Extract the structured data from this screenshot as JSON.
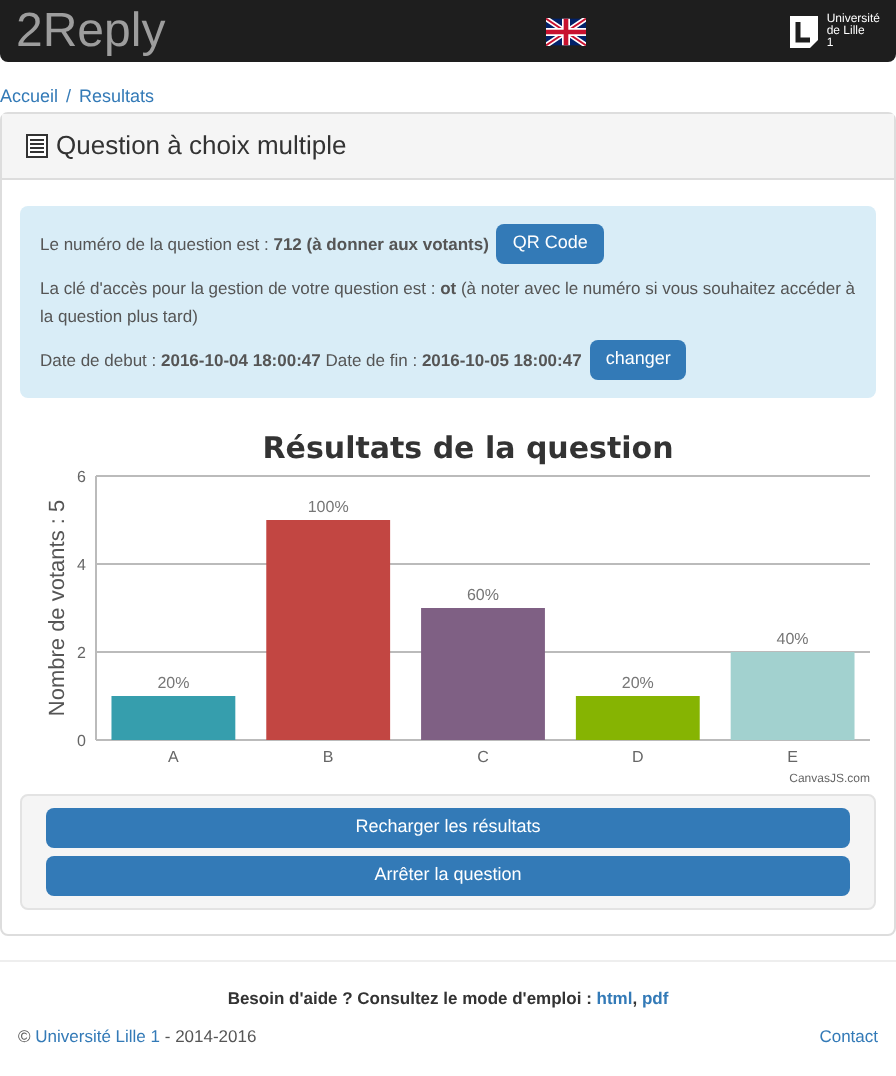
{
  "navbar": {
    "brand": "2Reply",
    "logo_lines": [
      "Université",
      "de Lille",
      "1"
    ]
  },
  "breadcrumb": [
    {
      "label": "Accueil"
    },
    {
      "label": "Resultats"
    }
  ],
  "breadcrumb_separator": "/",
  "panel": {
    "title": "Question à choix multiple",
    "info": [
      {
        "text": "Le numéro de la question est : **712 (à donner aux votants)**",
        "button": "QR Code"
      },
      {
        "text": "La clé d'accès pour la gestion de votre question est : **ot** (à noter avec le numéro si vous souhaitez accéder à la question plus tard)"
      },
      {
        "text": "Date de debut : **2016-10-04 18:00:47** Date de fin : **2016-10-05 18:00:47**",
        "button": "changer"
      }
    ],
    "chart_data": {
      "type": "bar",
      "title": "Résultats de la question",
      "ylabel": "Nombre de votants : 5",
      "categories": [
        "A",
        "B",
        "C",
        "D",
        "E"
      ],
      "series": [
        {
          "values": [
            1,
            5,
            3,
            1,
            2
          ]
        }
      ],
      "ylim": [
        0,
        6
      ],
      "yticks": [
        0,
        2,
        4,
        6
      ],
      "value_labels": [
        "20%",
        "100%",
        "60%",
        "20%",
        "40%"
      ]
    },
    "bars": [
      {
        "color": "#369ead"
      },
      {
        "color": "#c24642"
      },
      {
        "color": "#7f6084"
      },
      {
        "color": "#86b402"
      },
      {
        "color": "#a2d1cf"
      }
    ],
    "chart_credit": "CanvasJS.com",
    "actions": [
      "Recharger les résultats",
      "Arrêter la question"
    ]
  },
  "footer": {
    "help": "Besoin d'aide ? Consultez le mode d'emploi : ",
    "links": [
      "html",
      "pdf"
    ],
    "link_separator": ", ",
    "copyright": "©",
    "university": "Université Lille 1",
    "years": " - 2014-2016",
    "contact": "Contact"
  }
}
